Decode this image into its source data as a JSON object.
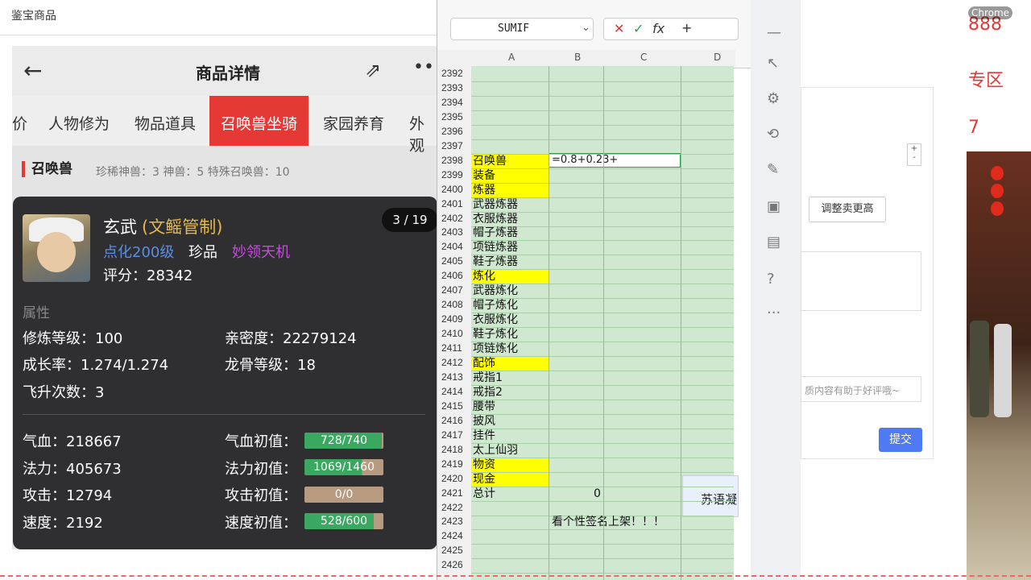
{
  "window": {
    "title": "鉴宝商品"
  },
  "phone": {
    "header_title": "商品详情",
    "back_icon": "←",
    "share_icon": "⇗",
    "more_icon": "•••",
    "tabs": [
      "价",
      "人物修为",
      "物品道具",
      "召唤兽坐骑",
      "家园养育",
      "外观"
    ],
    "active_tab": "召唤兽坐骑",
    "category": "召唤兽",
    "category_info": "珍稀神兽：3   神兽：5   特殊召唤兽：10"
  },
  "pet": {
    "name": "玄武",
    "subname": "(文鳐管制)",
    "counter": "3 / 19",
    "tag1": "点化200级",
    "tag2": "珍品",
    "tag3": "妙领天机",
    "score": "评分：28342",
    "attr_header": "属性",
    "stats": [
      [
        "修炼等级：100",
        "亲密度：22279124"
      ],
      [
        "成长率：1.274/1.274",
        "龙骨等级：18"
      ],
      [
        "飞升次数：3",
        ""
      ]
    ],
    "combat": [
      {
        "label": "气血：218667",
        "init_label": "气血初值：",
        "bar": "728/740",
        "fill": 0.984,
        "color": "#3aa860"
      },
      {
        "label": "法力：405673",
        "init_label": "法力初值：",
        "bar": "1069/1460",
        "fill": 0.73,
        "color": "#3aa860"
      },
      {
        "label": "攻击：12794",
        "init_label": "攻击初值：",
        "bar": "0/0",
        "fill": 0,
        "color": "#3aa860"
      },
      {
        "label": "速度：2192",
        "init_label": "速度初值：",
        "bar": "528/600",
        "fill": 0.88,
        "color": "#3aa860"
      }
    ],
    "bar_bg_color": "#b89a80"
  },
  "sheet": {
    "name_box": "SUMIF",
    "fx": "fx",
    "columns": [
      "A",
      "B",
      "C",
      "D"
    ],
    "rows": [
      {
        "n": "2392",
        "a": ""
      },
      {
        "n": "2393",
        "a": ""
      },
      {
        "n": "2394",
        "a": ""
      },
      {
        "n": "2395",
        "a": ""
      },
      {
        "n": "2396",
        "a": ""
      },
      {
        "n": "2397",
        "a": ""
      },
      {
        "n": "2398",
        "a": "召唤兽",
        "y": true
      },
      {
        "n": "2399",
        "a": "装备",
        "y": true
      },
      {
        "n": "2400",
        "a": "炼器",
        "y": true
      },
      {
        "n": "2401",
        "a": "武器炼器"
      },
      {
        "n": "2402",
        "a": "衣服炼器"
      },
      {
        "n": "2403",
        "a": "帽子炼器"
      },
      {
        "n": "2404",
        "a": "项链炼器"
      },
      {
        "n": "2405",
        "a": "鞋子炼器"
      },
      {
        "n": "2406",
        "a": "炼化",
        "y": true
      },
      {
        "n": "2407",
        "a": "武器炼化"
      },
      {
        "n": "2408",
        "a": "帽子炼化"
      },
      {
        "n": "2409",
        "a": "衣服炼化"
      },
      {
        "n": "2410",
        "a": "鞋子炼化"
      },
      {
        "n": "2411",
        "a": "项链炼化"
      },
      {
        "n": "2412",
        "a": "配饰",
        "y": true
      },
      {
        "n": "2413",
        "a": "戒指1"
      },
      {
        "n": "2414",
        "a": "戒指2"
      },
      {
        "n": "2415",
        "a": "腰带"
      },
      {
        "n": "2416",
        "a": "披风"
      },
      {
        "n": "2417",
        "a": "挂件"
      },
      {
        "n": "2418",
        "a": "太上仙羽"
      },
      {
        "n": "2419",
        "a": "物资",
        "y": true
      },
      {
        "n": "2420",
        "a": "现金",
        "y": true
      },
      {
        "n": "2421",
        "a": "总计",
        "b": "0"
      },
      {
        "n": "2422",
        "a": ""
      },
      {
        "n": "2423",
        "a": "",
        "b": "看个性签名上架！！！"
      },
      {
        "n": "2424",
        "a": ""
      },
      {
        "n": "2425",
        "a": ""
      },
      {
        "n": "2426",
        "a": ""
      }
    ],
    "editing_value": "=0.8+0.23+",
    "d_cell": "苏语凝"
  },
  "dialog": {
    "adjust_button": "调整卖更高",
    "placeholder": "质内容有助于好评哦~",
    "submit": "提交"
  },
  "right": {
    "logo": "Chrome",
    "line1": "888",
    "line2": "专区",
    "line3": "7"
  }
}
